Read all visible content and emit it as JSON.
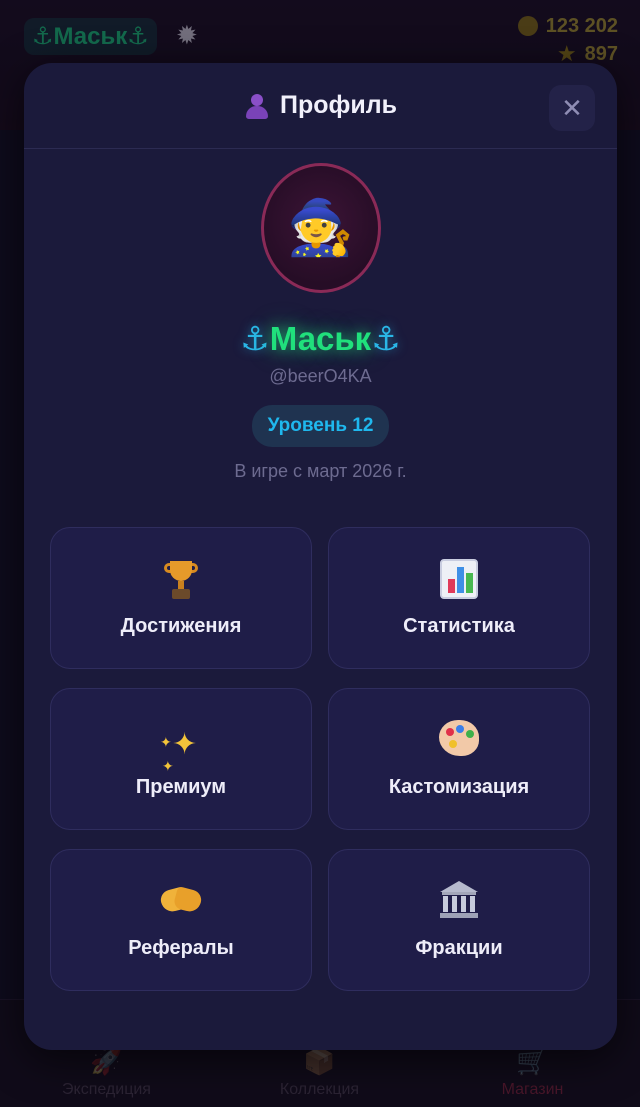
{
  "background": {
    "player_name": "⚓Маськ⚓",
    "coins": "123 202",
    "stars": "897",
    "tabs": [
      {
        "label": "Экспедиция",
        "icon": "rocket-icon"
      },
      {
        "label": "Коллекция",
        "icon": "box-icon"
      },
      {
        "label": "Магазин",
        "icon": "shop-icon"
      }
    ]
  },
  "modal": {
    "title": "Профиль",
    "title_icon": "user-icon",
    "close_icon": "close-icon",
    "close_glyph": "✕"
  },
  "profile": {
    "avatar_glyph": "🧙",
    "avatar_icon": "wizard-avatar",
    "name_text": "Маськ",
    "name_decor": "⚓",
    "handle": "@beerO4KA",
    "level": "Уровень 12",
    "since": "В игре с март 2026 г."
  },
  "menu": {
    "achievements": {
      "label": "Достижения",
      "icon": "trophy-icon"
    },
    "statistics": {
      "label": "Статистика",
      "icon": "bar-chart-icon"
    },
    "premium": {
      "label": "Премиум",
      "icon": "sparkles-icon"
    },
    "customization": {
      "label": "Кастомизация",
      "icon": "palette-icon"
    },
    "referrals": {
      "label": "Рефералы",
      "icon": "handshake-icon"
    },
    "factions": {
      "label": "Фракции",
      "icon": "bank-icon"
    }
  },
  "colors": {
    "modal_bg": "#1b1a3b",
    "tile_bg": "#1f1d48",
    "name_green": "#20e07c",
    "anchor_blue": "#2ab6e6",
    "level_text": "#1fb8ee",
    "avatar_border": "#8a2a57"
  }
}
